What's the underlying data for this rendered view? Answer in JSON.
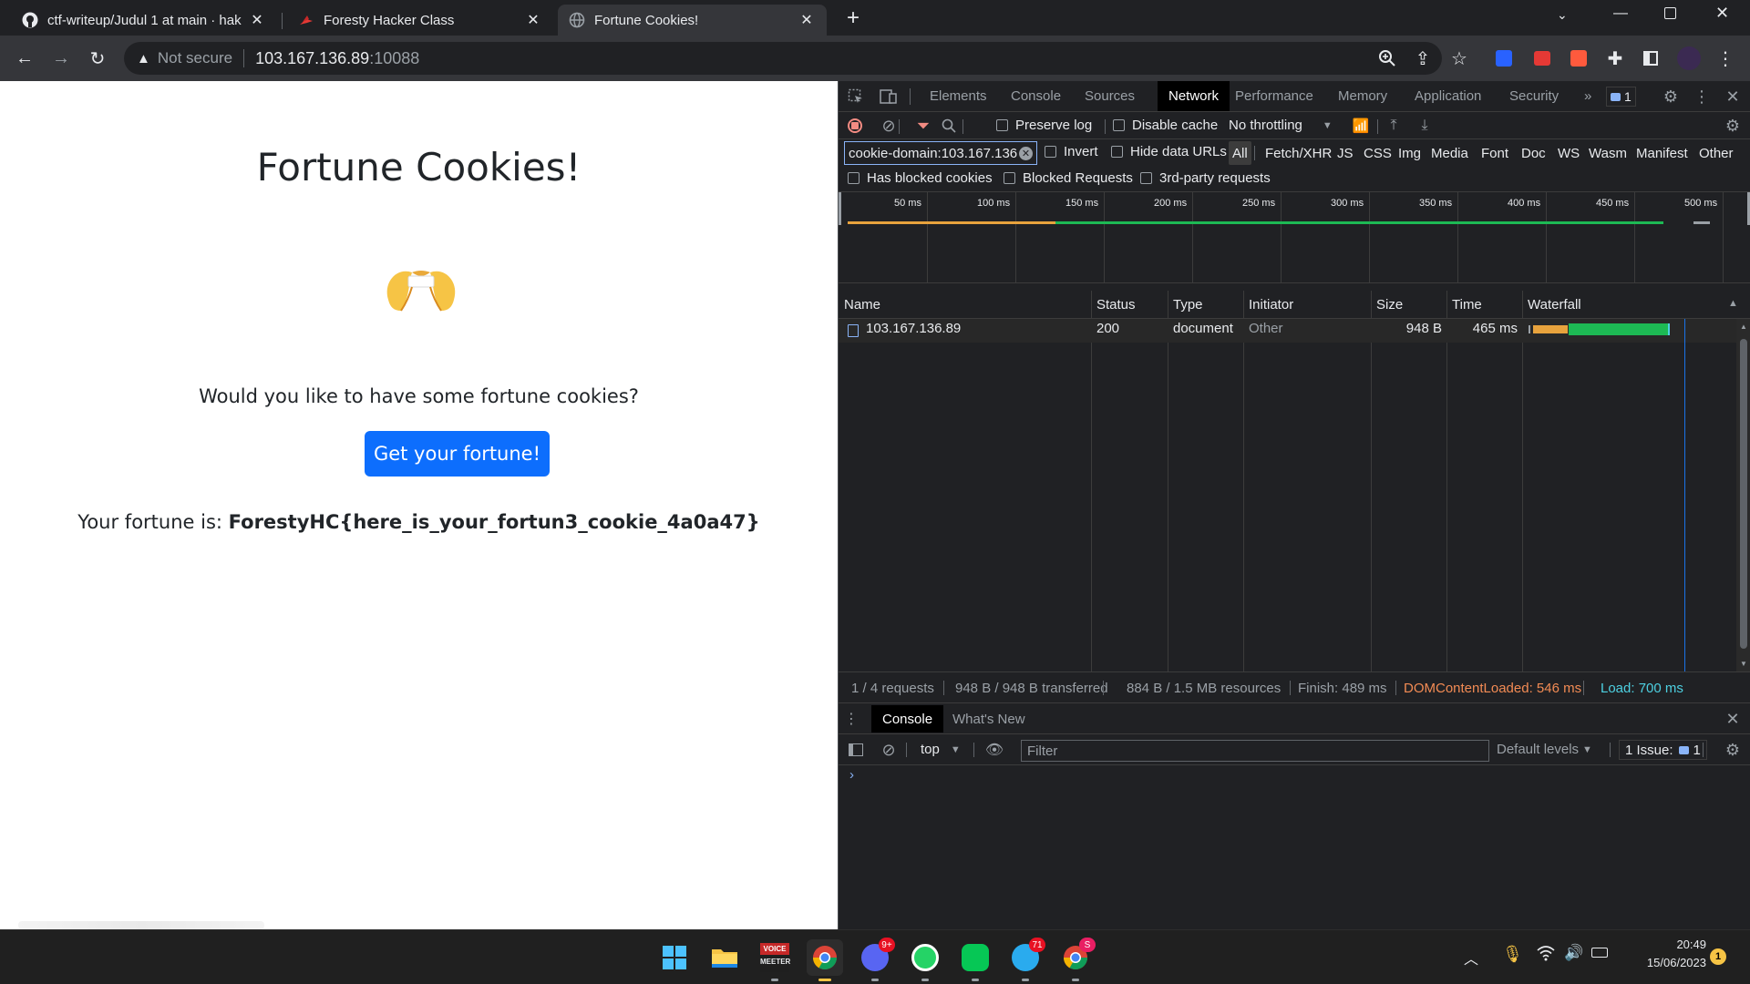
{
  "browser": {
    "tabs": [
      {
        "title": "ctf-writeup/Judul 1 at main · hak",
        "favicon": "github-icon"
      },
      {
        "title": "Foresty Hacker Class",
        "favicon": "foresty-icon"
      },
      {
        "title": "Fortune Cookies!",
        "favicon": "globe-icon"
      }
    ],
    "security_label": "Not secure",
    "url_host": "103.167.136.89",
    "url_port": ":10088"
  },
  "page": {
    "heading": "Fortune Cookies!",
    "question": "Would you like to have some fortune cookies?",
    "button_label": "Get your fortune!",
    "result_prefix": "Your fortune is: ",
    "result_value": "ForestyHC{here_is_your_fortun3_cookie_4a0a47}"
  },
  "devtools": {
    "tabs": [
      "Elements",
      "Console",
      "Sources",
      "Network",
      "Performance",
      "Memory",
      "Application",
      "Security"
    ],
    "active_tab": "Network",
    "issues_count": "1",
    "toolbar": {
      "preserve_log": "Preserve log",
      "disable_cache": "Disable cache",
      "throttling": "No throttling"
    },
    "filter_value": "cookie-domain:103.167.136",
    "invert": "Invert",
    "hide_data_urls": "Hide data URLs",
    "type_filters": [
      "All",
      "Fetch/XHR",
      "JS",
      "CSS",
      "Img",
      "Media",
      "Font",
      "Doc",
      "WS",
      "Wasm",
      "Manifest",
      "Other"
    ],
    "has_blocked_cookies": "Has blocked cookies",
    "blocked_requests": "Blocked Requests",
    "third_party": "3rd-party requests",
    "timeline_ticks": [
      "50 ms",
      "100 ms",
      "150 ms",
      "200 ms",
      "250 ms",
      "300 ms",
      "350 ms",
      "400 ms",
      "450 ms",
      "500 ms"
    ],
    "columns": [
      "Name",
      "Status",
      "Type",
      "Initiator",
      "Size",
      "Time",
      "Waterfall"
    ],
    "rows": [
      {
        "name": "103.167.136.89",
        "status": "200",
        "type": "document",
        "initiator": "Other",
        "size": "948 B",
        "time": "465 ms"
      }
    ],
    "summary": {
      "requests": "1 / 4 requests",
      "transferred": "948 B / 948 B transferred",
      "resources": "884 B / 1.5 MB resources",
      "finish": "Finish: 489 ms",
      "dom_loaded": "DOMContentLoaded: 546 ms",
      "load": "Load: 700 ms"
    },
    "drawer": {
      "tabs": [
        "Console",
        "What's New"
      ],
      "context": "top",
      "filter_placeholder": "Filter",
      "levels": "Default levels",
      "issues_label": "1 Issue:",
      "issues_count": "1"
    },
    "colors": {
      "dom_loaded": "#f28b54",
      "load": "#4dd0e1",
      "waiting": "#e8a33d",
      "download": "#1db954"
    }
  },
  "taskbar": {
    "apps": [
      "windows-start-icon",
      "file-explorer-icon",
      "voicemeeter-icon",
      "chrome-icon",
      "discord-icon",
      "whatsapp-icon",
      "line-icon",
      "telegram-icon",
      "chrome-profile-icon"
    ],
    "voicemeeter_label_top": "VOICE",
    "voicemeeter_label_bottom": "MEETER",
    "discord_badge": "9+",
    "telegram_badge": "71",
    "chrome_profile_badge": "S",
    "time": "20:49",
    "date": "15/06/2023",
    "notification_count": "1"
  }
}
